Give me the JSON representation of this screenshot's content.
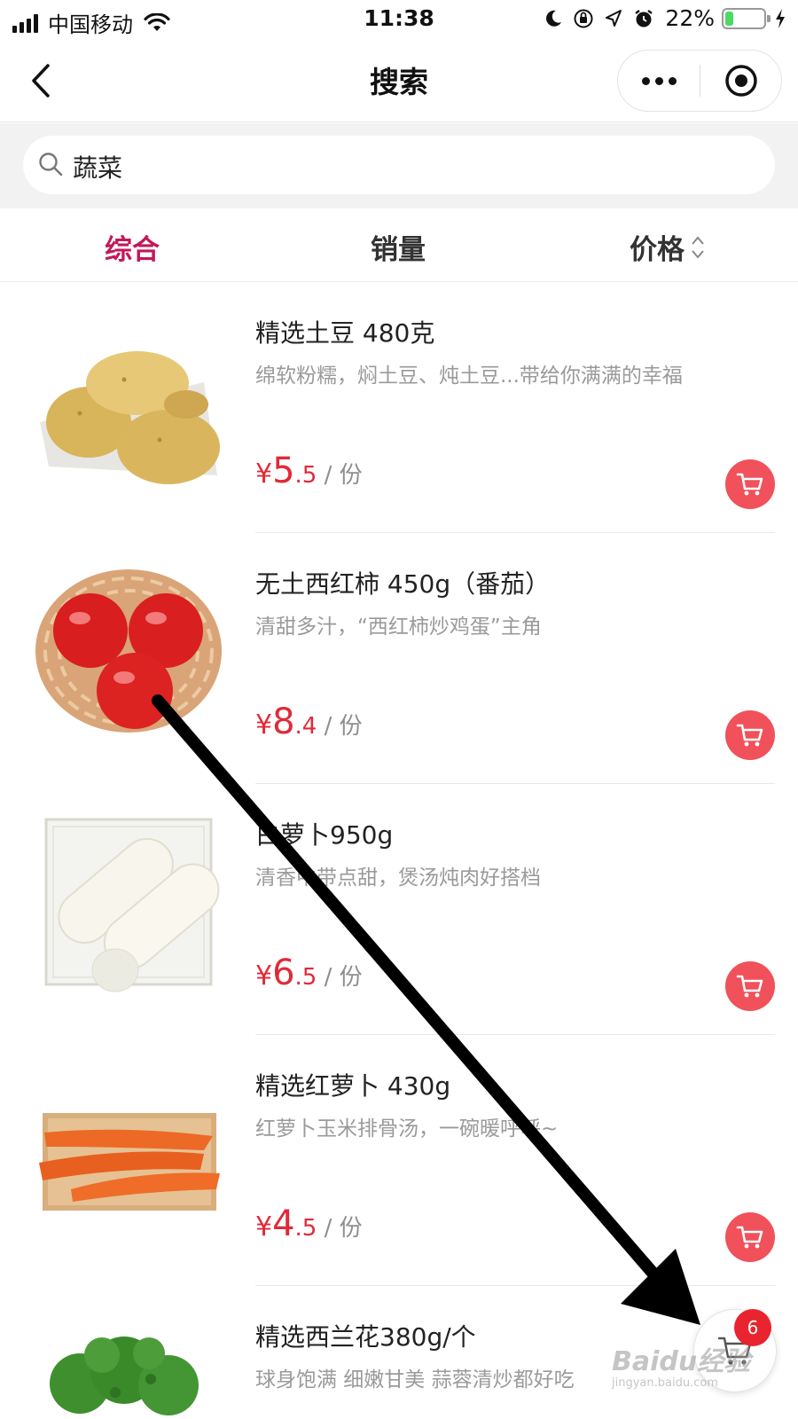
{
  "status_bar": {
    "carrier": "中国移动",
    "time": "11:38",
    "battery_percent": "22%",
    "battery_level": 0.22,
    "icons": [
      "signal-icon",
      "wifi-icon",
      "moon-icon",
      "rotation-lock-icon",
      "location-icon",
      "alarm-icon",
      "battery-icon",
      "charging-icon"
    ]
  },
  "nav": {
    "title": "搜索",
    "icons": [
      "back-chevron-icon",
      "more-dots-icon",
      "close-target-icon"
    ]
  },
  "search": {
    "query": "蔬菜",
    "icon": "search-icon"
  },
  "tabs": [
    {
      "label": "综合",
      "active": true
    },
    {
      "label": "销量",
      "active": false
    },
    {
      "label": "价格",
      "active": false,
      "icon": "sort-updown-icon"
    }
  ],
  "products": [
    {
      "name": "精选土豆 480克",
      "desc": "绵软粉糯，焖土豆、炖土豆...带给你满满的幸福",
      "currency": "¥",
      "price_int": "5",
      "price_dec": ".5",
      "unit": " / 份",
      "image": "potato"
    },
    {
      "name": "无土西红柿 450g（番茄）",
      "desc": "清甜多汁，“西红柿炒鸡蛋”主角",
      "currency": "¥",
      "price_int": "8",
      "price_dec": ".4",
      "unit": " / 份",
      "image": "tomato"
    },
    {
      "name": "白萝卜950g",
      "desc": "清香中带点甜，煲汤炖肉好搭档",
      "currency": "¥",
      "price_int": "6",
      "price_dec": ".5",
      "unit": " / 份",
      "image": "radish"
    },
    {
      "name": "精选红萝卜 430g",
      "desc": "红萝卜玉米排骨汤，一碗暖呼呼~",
      "currency": "¥",
      "price_int": "4",
      "price_dec": ".5",
      "unit": " / 份",
      "image": "carrot"
    },
    {
      "name": "精选西兰花380g/个",
      "desc": "球身饱满 细嫩甘美 蒜蓉清炒都好吃",
      "currency": "¥",
      "price_int": "",
      "price_dec": "",
      "unit": "",
      "image": "broccoli"
    }
  ],
  "cart": {
    "count": "6",
    "icon": "cart-icon"
  },
  "watermark": {
    "brand": "Baidu经验",
    "url": "jingyan.baidu.com"
  },
  "colors": {
    "accent": "#c2185b",
    "price": "#e02a38",
    "cart_button": "#f0515a",
    "badge": "#e8242e"
  }
}
